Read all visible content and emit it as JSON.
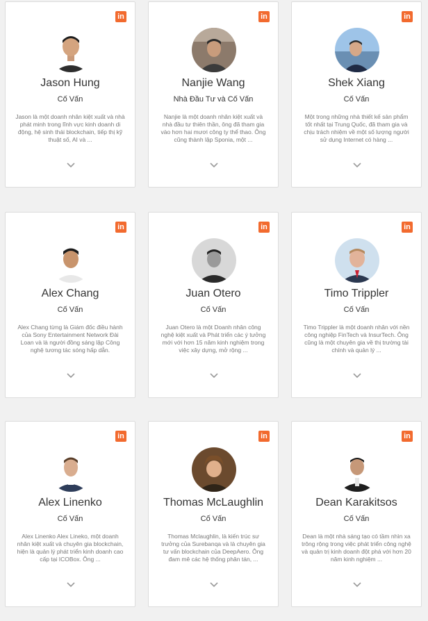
{
  "linkedin_icon_text": "in",
  "colors": {
    "linkedin_badge": "#f26a2e",
    "page_bg": "#f1f1f1",
    "card_bg": "#ffffff"
  },
  "advisors": [
    {
      "name": "Jason Hung",
      "role": "Cố Vấn",
      "bio": "Jason là một doanh nhân kiệt xuất và nhà phát minh trong lĩnh vực kinh doanh di động, hệ sinh thái blockchain, tiếp thị kỹ thuật số, AI và ..."
    },
    {
      "name": "Nanjie Wang",
      "role": "Nhà Đầu Tư và Cố Vấn",
      "bio": "Nanjie là một doanh nhân kiệt xuất và nhà đầu tư thiên thần, ông đã tham gia vào hơn hai mươi công ty thể thao. Ông cũng thành lập Sponia, một ..."
    },
    {
      "name": "Shek Xiang",
      "role": "Cố Vấn",
      "bio": "Một trong những nhà thiết kế sản phẩm tốt nhất tại Trung Quốc, đã tham gia và chịu trách nhiệm về một số lượng người sử dụng Internet có hàng ..."
    },
    {
      "name": "Alex Chang",
      "role": "Cố Vấn",
      "bio": "Alex Chang từng là Giám đốc điều hành của Sony Entertainment Network Đài Loan và là người đồng sáng lập Công nghệ tương tác sóng hấp dẫn."
    },
    {
      "name": "Juan Otero",
      "role": "Cố Vấn",
      "bio": "Juan Otero là một Doanh nhân công nghệ kiệt xuất và Phát triển các ý tưởng mới với hơn 15 năm kinh nghiệm trong việc xây dựng, mở rộng ..."
    },
    {
      "name": "Timo Trippler",
      "role": "Cố Vấn",
      "bio": "Timo Trippler là một doanh nhân với nền công nghiệp FinTech và InsurTech. Ông cũng là một chuyên gia về thị trường tài chính và quản lý ..."
    },
    {
      "name": "Alex Linenko",
      "role": "Cố Vấn",
      "bio": "Alex Linenko Alex Lineko, một doanh nhân kiệt xuất và chuyên gia blockchain, hiện là quản lý phát triển kinh doanh cao cấp tại ICOBox. Ông ..."
    },
    {
      "name": "Thomas McLaughlin",
      "role": "Cố Vấn",
      "bio": "Thomas Mclaughlin, là kiến trúc sư trưởng của Surebanqa và là chuyên gia tư vấn blockchain của DeepAero. Ông đam mê các hệ thống phân tán, ..."
    },
    {
      "name": "Dean Karakitsos",
      "role": "Cố Vấn",
      "bio": "Dean là một nhà sáng tạo có tầm nhìn xa trông rộng trong việc phát triển công nghệ và quản trị kinh doanh đột phá với hơn 20 năm kinh nghiệm ..."
    }
  ]
}
